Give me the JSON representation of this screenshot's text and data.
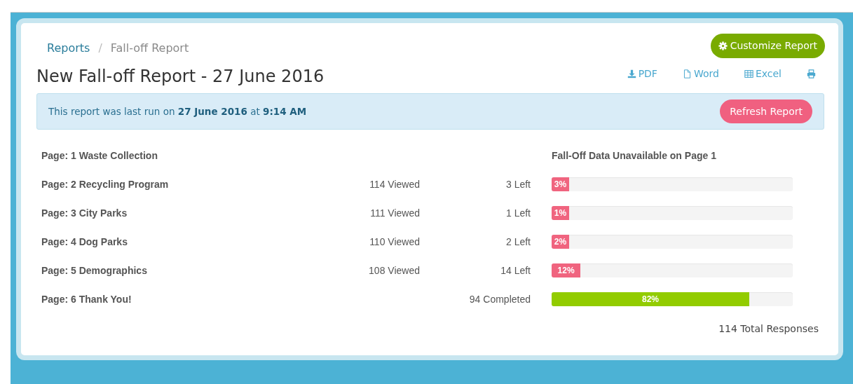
{
  "breadcrumb": [
    {
      "label": "Reports",
      "link": true
    },
    {
      "label": "Fall-off Report",
      "link": false
    }
  ],
  "breadcrumb_separator": "/",
  "customize_button": "Customize Report",
  "title": "New Fall-off Report - 27 June 2016",
  "exports": [
    {
      "kind": "download",
      "label": "PDF"
    },
    {
      "kind": "file",
      "label": "Word"
    },
    {
      "kind": "table",
      "label": "Excel"
    },
    {
      "kind": "print"
    }
  ],
  "notice": {
    "text": "This report was last run on **27 June 2016** at **9:14 AM**",
    "button": "Refresh Report"
  },
  "rows": [
    {
      "kind": "note",
      "name": "Page: 1 Waste Collection",
      "note": "Fall-Off Data Unavailable on Page 1"
    },
    {
      "kind": "dropoff",
      "name": "Page: 2 Recycling Program",
      "viewed": "114 Viewed",
      "count": "3 Left",
      "level": 0.03,
      "percent": "3%"
    },
    {
      "kind": "dropoff",
      "name": "Page: 3 City Parks",
      "viewed": "111 Viewed",
      "count": "1 Left",
      "level": 0.01,
      "percent": "1%"
    },
    {
      "kind": "dropoff",
      "name": "Page: 4 Dog Parks",
      "viewed": "110 Viewed",
      "count": "2 Left",
      "level": 0.02,
      "percent": "2%"
    },
    {
      "kind": "dropoff",
      "name": "Page: 5 Demographics",
      "viewed": "108 Viewed",
      "count": "14 Left",
      "level": 0.12,
      "percent": "12%"
    },
    {
      "kind": "complete",
      "name": "Page: 6 Thank You!",
      "count": "94 Completed",
      "level": 0.82,
      "percent": "82%"
    }
  ],
  "total": "114 Total Responses"
}
